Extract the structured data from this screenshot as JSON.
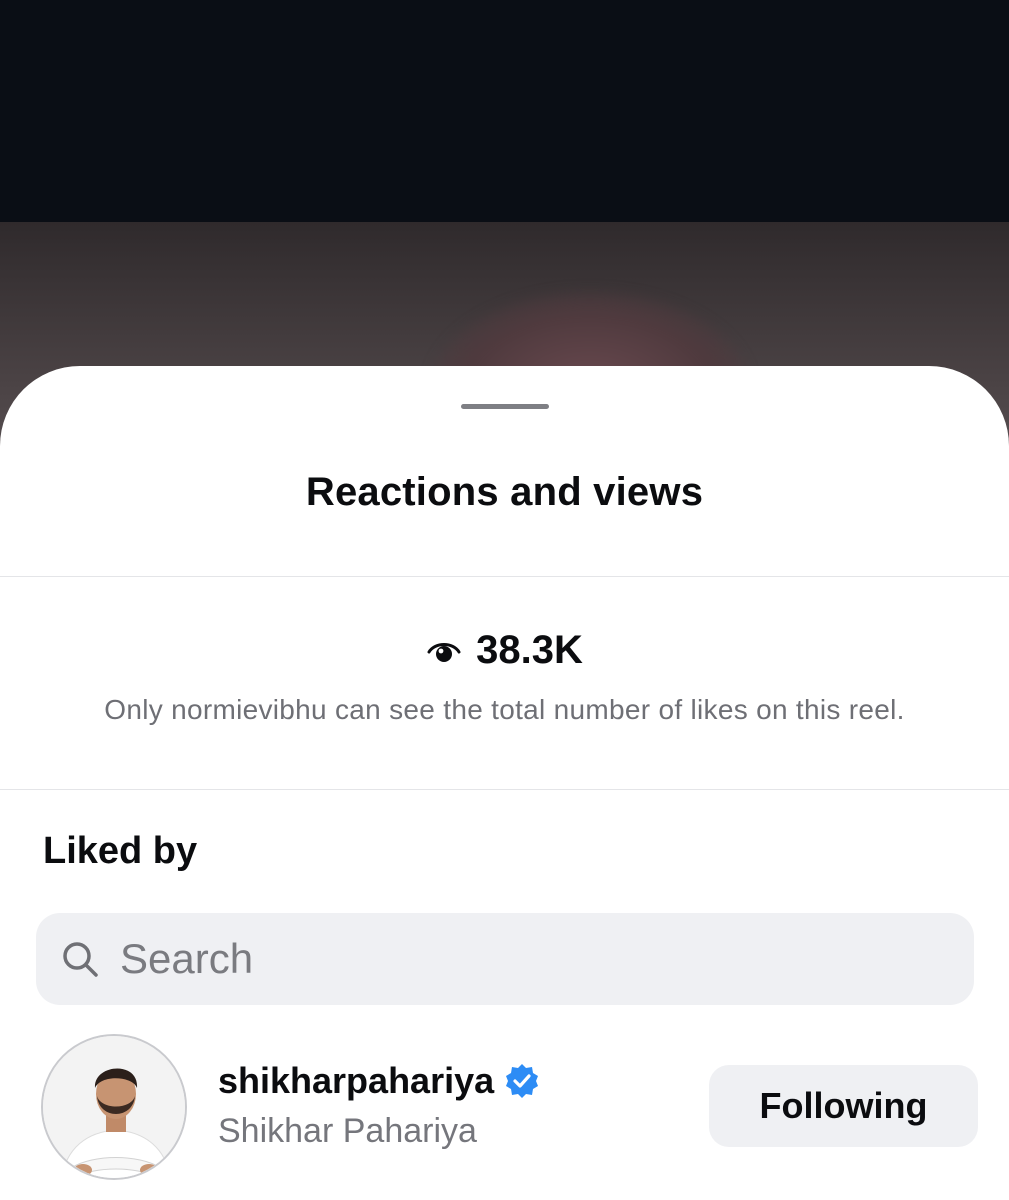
{
  "sheet": {
    "title": "Reactions and views",
    "views": {
      "icon": "eye-icon",
      "count": "38.3K"
    },
    "likes_note": "Only normievibhu can see the total number of likes on this reel.",
    "liked_by_heading": "Liked by",
    "search": {
      "icon": "search-icon",
      "placeholder": "Search"
    },
    "users": [
      {
        "username": "shikharpahariya",
        "verified": true,
        "full_name": "Shikhar Pahariya",
        "button_label": "Following"
      }
    ]
  },
  "colors": {
    "verified_badge": "#2d8cf5",
    "search_bg": "#eff0f3",
    "button_bg": "#eff0f3",
    "secondary_text": "#6e6f75"
  }
}
